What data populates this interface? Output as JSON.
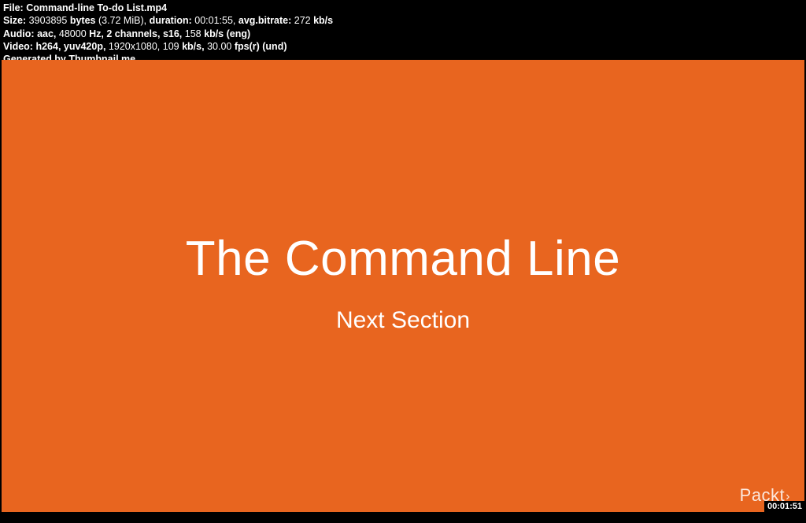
{
  "meta": {
    "file_label": "File:",
    "file_value": "Command-line To-do List.mp4",
    "size_label": "Size:",
    "size_bytes": "3903895",
    "size_bytes_unit": "bytes",
    "size_mib": "(3.72 MiB),",
    "duration_label": "duration:",
    "duration_value": "00:01:55,",
    "avgbitrate_label": "avg.bitrate:",
    "avgbitrate_value": "272",
    "avgbitrate_unit": "kb/s",
    "audio_label": "Audio:",
    "audio_codec": "aac,",
    "audio_hz": "48000",
    "audio_hz_unit": "Hz,",
    "audio_channels": "2 channels,",
    "audio_s16": "s16,",
    "audio_bitrate": "158",
    "audio_bitrate_unit": "kb/s (eng)",
    "video_label": "Video:",
    "video_codec": "h264,",
    "video_pixfmt": "yuv420p,",
    "video_res": "1920x1080,",
    "video_bitrate": "109",
    "video_bitrate_unit": "kb/s,",
    "video_fps": "30.00",
    "video_fps_unit": "fps(r) (und)",
    "generated": "Generated by Thumbnail me"
  },
  "frame": {
    "title": "The Command Line",
    "subtitle": "Next Section",
    "brand": "Packt",
    "brand_chev": "›",
    "timestamp": "00:01:51"
  }
}
